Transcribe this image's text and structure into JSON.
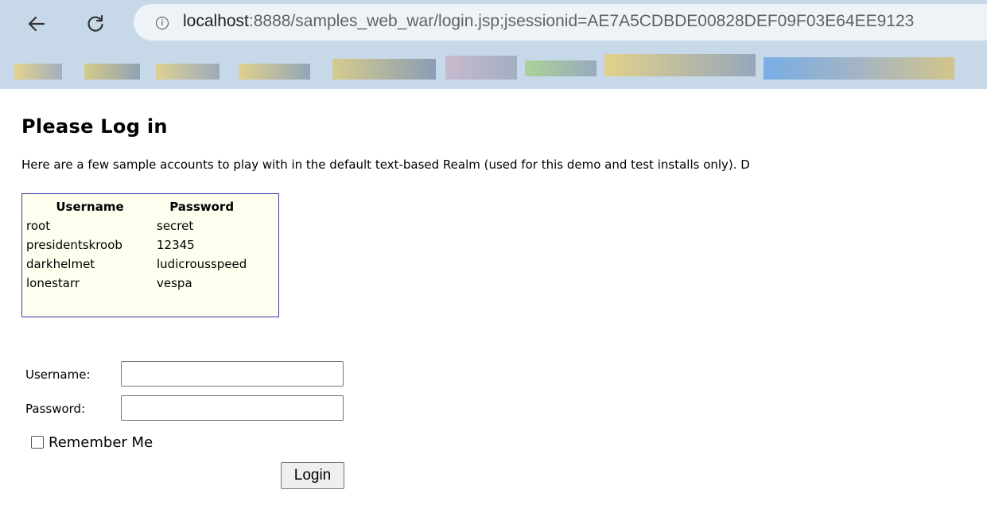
{
  "browser": {
    "url_host": "localhost",
    "url_rest": ":8888/samples_web_war/login.jsp;jsessionid=AE7A5CDBDE00828DEF09F03E64EE9123",
    "info_icon_glyph": "i",
    "icons": [
      "back-arrow-icon",
      "reload-icon",
      "info-icon"
    ]
  },
  "page": {
    "title": "Please Log in",
    "intro": "Here are a few sample accounts to play with in the default text-based Realm (used for this demo and test installs only). D",
    "accounts_table": {
      "headers": [
        "Username",
        "Password"
      ],
      "rows": [
        [
          "root",
          "secret"
        ],
        [
          "presidentskroob",
          "12345"
        ],
        [
          "darkhelmet",
          "ludicrousspeed"
        ],
        [
          "lonestarr",
          "vespa"
        ]
      ]
    },
    "form": {
      "username_label": "Username:",
      "username_value": "",
      "password_label": "Password:",
      "password_value": "",
      "remember_label": "Remember Me",
      "remember_checked": false,
      "login_label": "Login"
    }
  },
  "colors": {
    "chrome_bg": "#c7d8e8",
    "table_bg": "#fffff0",
    "table_border": "#3a3aaf"
  }
}
